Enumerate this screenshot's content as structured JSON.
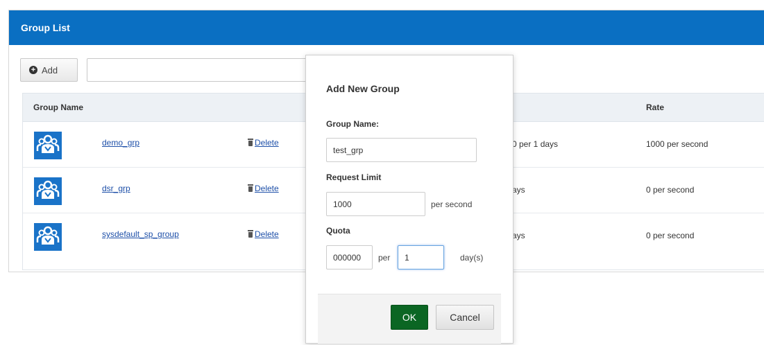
{
  "panel": {
    "title": "Group List",
    "accent_color": "#0a6fc2"
  },
  "toolbar": {
    "add_label": "Add",
    "add_icon": "plus-circle-icon",
    "search_value": ""
  },
  "table": {
    "columns": [
      "Group Name",
      "Rate"
    ],
    "rows": [
      {
        "icon": "group-icon",
        "name": "demo_grp",
        "delete_label": "Delete",
        "quota": "0 per 1 days",
        "rate": "1000 per second"
      },
      {
        "icon": "group-icon",
        "name": "dsr_grp",
        "delete_label": "Delete",
        "quota": "ays",
        "rate": "0 per second"
      },
      {
        "icon": "group-icon",
        "name": "sysdefault_sp_group",
        "delete_label": "Delete",
        "quota": "ays",
        "rate": "0 per second"
      }
    ]
  },
  "modal": {
    "title": "Add New Group",
    "group_name_label": "Group Name:",
    "group_name_value": "test_grp",
    "request_limit_label": "Request Limit",
    "request_limit_value": "1000",
    "request_limit_unit": "per second",
    "quota_label": "Quota",
    "quota_value": "000000",
    "quota_per": "per",
    "quota_days_value": "1",
    "quota_days_unit": "day(s)",
    "ok_label": "OK",
    "cancel_label": "Cancel",
    "ok_color": "#0b6623"
  }
}
